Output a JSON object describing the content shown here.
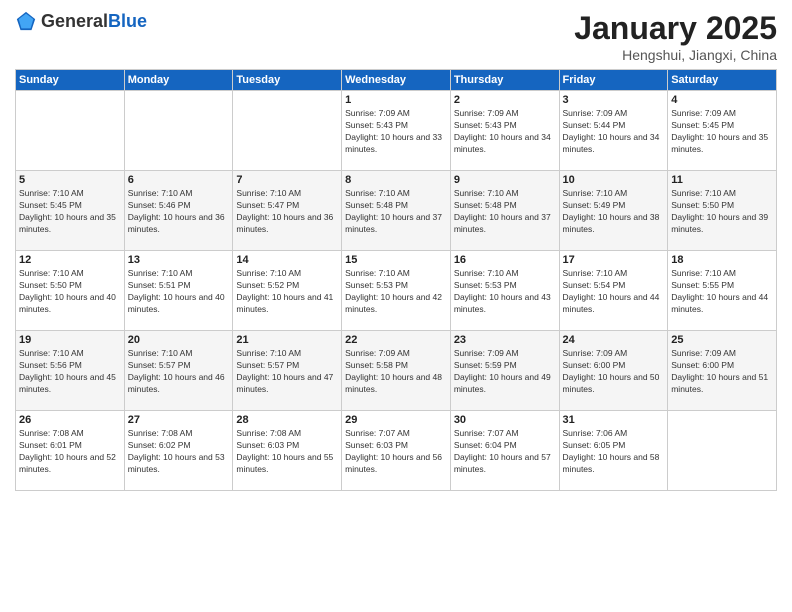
{
  "header": {
    "logo_general": "General",
    "logo_blue": "Blue",
    "title": "January 2025",
    "subtitle": "Hengshui, Jiangxi, China"
  },
  "weekdays": [
    "Sunday",
    "Monday",
    "Tuesday",
    "Wednesday",
    "Thursday",
    "Friday",
    "Saturday"
  ],
  "weeks": [
    [
      {
        "day": "",
        "sunrise": "",
        "sunset": "",
        "daylight": ""
      },
      {
        "day": "",
        "sunrise": "",
        "sunset": "",
        "daylight": ""
      },
      {
        "day": "",
        "sunrise": "",
        "sunset": "",
        "daylight": ""
      },
      {
        "day": "1",
        "sunrise": "Sunrise: 7:09 AM",
        "sunset": "Sunset: 5:43 PM",
        "daylight": "Daylight: 10 hours and 33 minutes."
      },
      {
        "day": "2",
        "sunrise": "Sunrise: 7:09 AM",
        "sunset": "Sunset: 5:43 PM",
        "daylight": "Daylight: 10 hours and 34 minutes."
      },
      {
        "day": "3",
        "sunrise": "Sunrise: 7:09 AM",
        "sunset": "Sunset: 5:44 PM",
        "daylight": "Daylight: 10 hours and 34 minutes."
      },
      {
        "day": "4",
        "sunrise": "Sunrise: 7:09 AM",
        "sunset": "Sunset: 5:45 PM",
        "daylight": "Daylight: 10 hours and 35 minutes."
      }
    ],
    [
      {
        "day": "5",
        "sunrise": "Sunrise: 7:10 AM",
        "sunset": "Sunset: 5:45 PM",
        "daylight": "Daylight: 10 hours and 35 minutes."
      },
      {
        "day": "6",
        "sunrise": "Sunrise: 7:10 AM",
        "sunset": "Sunset: 5:46 PM",
        "daylight": "Daylight: 10 hours and 36 minutes."
      },
      {
        "day": "7",
        "sunrise": "Sunrise: 7:10 AM",
        "sunset": "Sunset: 5:47 PM",
        "daylight": "Daylight: 10 hours and 36 minutes."
      },
      {
        "day": "8",
        "sunrise": "Sunrise: 7:10 AM",
        "sunset": "Sunset: 5:48 PM",
        "daylight": "Daylight: 10 hours and 37 minutes."
      },
      {
        "day": "9",
        "sunrise": "Sunrise: 7:10 AM",
        "sunset": "Sunset: 5:48 PM",
        "daylight": "Daylight: 10 hours and 37 minutes."
      },
      {
        "day": "10",
        "sunrise": "Sunrise: 7:10 AM",
        "sunset": "Sunset: 5:49 PM",
        "daylight": "Daylight: 10 hours and 38 minutes."
      },
      {
        "day": "11",
        "sunrise": "Sunrise: 7:10 AM",
        "sunset": "Sunset: 5:50 PM",
        "daylight": "Daylight: 10 hours and 39 minutes."
      }
    ],
    [
      {
        "day": "12",
        "sunrise": "Sunrise: 7:10 AM",
        "sunset": "Sunset: 5:50 PM",
        "daylight": "Daylight: 10 hours and 40 minutes."
      },
      {
        "day": "13",
        "sunrise": "Sunrise: 7:10 AM",
        "sunset": "Sunset: 5:51 PM",
        "daylight": "Daylight: 10 hours and 40 minutes."
      },
      {
        "day": "14",
        "sunrise": "Sunrise: 7:10 AM",
        "sunset": "Sunset: 5:52 PM",
        "daylight": "Daylight: 10 hours and 41 minutes."
      },
      {
        "day": "15",
        "sunrise": "Sunrise: 7:10 AM",
        "sunset": "Sunset: 5:53 PM",
        "daylight": "Daylight: 10 hours and 42 minutes."
      },
      {
        "day": "16",
        "sunrise": "Sunrise: 7:10 AM",
        "sunset": "Sunset: 5:53 PM",
        "daylight": "Daylight: 10 hours and 43 minutes."
      },
      {
        "day": "17",
        "sunrise": "Sunrise: 7:10 AM",
        "sunset": "Sunset: 5:54 PM",
        "daylight": "Daylight: 10 hours and 44 minutes."
      },
      {
        "day": "18",
        "sunrise": "Sunrise: 7:10 AM",
        "sunset": "Sunset: 5:55 PM",
        "daylight": "Daylight: 10 hours and 44 minutes."
      }
    ],
    [
      {
        "day": "19",
        "sunrise": "Sunrise: 7:10 AM",
        "sunset": "Sunset: 5:56 PM",
        "daylight": "Daylight: 10 hours and 45 minutes."
      },
      {
        "day": "20",
        "sunrise": "Sunrise: 7:10 AM",
        "sunset": "Sunset: 5:57 PM",
        "daylight": "Daylight: 10 hours and 46 minutes."
      },
      {
        "day": "21",
        "sunrise": "Sunrise: 7:10 AM",
        "sunset": "Sunset: 5:57 PM",
        "daylight": "Daylight: 10 hours and 47 minutes."
      },
      {
        "day": "22",
        "sunrise": "Sunrise: 7:09 AM",
        "sunset": "Sunset: 5:58 PM",
        "daylight": "Daylight: 10 hours and 48 minutes."
      },
      {
        "day": "23",
        "sunrise": "Sunrise: 7:09 AM",
        "sunset": "Sunset: 5:59 PM",
        "daylight": "Daylight: 10 hours and 49 minutes."
      },
      {
        "day": "24",
        "sunrise": "Sunrise: 7:09 AM",
        "sunset": "Sunset: 6:00 PM",
        "daylight": "Daylight: 10 hours and 50 minutes."
      },
      {
        "day": "25",
        "sunrise": "Sunrise: 7:09 AM",
        "sunset": "Sunset: 6:00 PM",
        "daylight": "Daylight: 10 hours and 51 minutes."
      }
    ],
    [
      {
        "day": "26",
        "sunrise": "Sunrise: 7:08 AM",
        "sunset": "Sunset: 6:01 PM",
        "daylight": "Daylight: 10 hours and 52 minutes."
      },
      {
        "day": "27",
        "sunrise": "Sunrise: 7:08 AM",
        "sunset": "Sunset: 6:02 PM",
        "daylight": "Daylight: 10 hours and 53 minutes."
      },
      {
        "day": "28",
        "sunrise": "Sunrise: 7:08 AM",
        "sunset": "Sunset: 6:03 PM",
        "daylight": "Daylight: 10 hours and 55 minutes."
      },
      {
        "day": "29",
        "sunrise": "Sunrise: 7:07 AM",
        "sunset": "Sunset: 6:03 PM",
        "daylight": "Daylight: 10 hours and 56 minutes."
      },
      {
        "day": "30",
        "sunrise": "Sunrise: 7:07 AM",
        "sunset": "Sunset: 6:04 PM",
        "daylight": "Daylight: 10 hours and 57 minutes."
      },
      {
        "day": "31",
        "sunrise": "Sunrise: 7:06 AM",
        "sunset": "Sunset: 6:05 PM",
        "daylight": "Daylight: 10 hours and 58 minutes."
      },
      {
        "day": "",
        "sunrise": "",
        "sunset": "",
        "daylight": ""
      }
    ]
  ]
}
